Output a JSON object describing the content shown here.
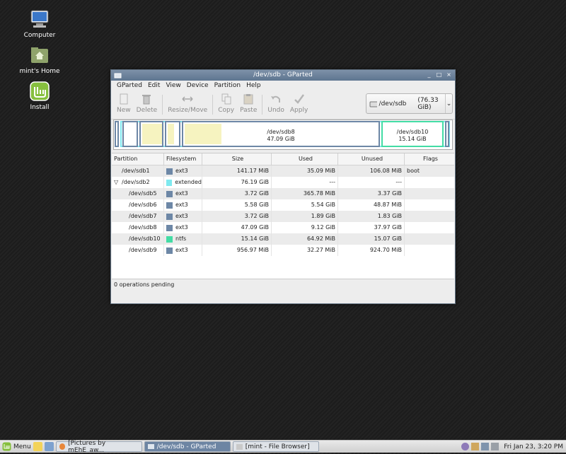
{
  "desktop": {
    "icons": [
      {
        "label": "Computer"
      },
      {
        "label": "mint's Home"
      },
      {
        "label": "Install"
      }
    ]
  },
  "window": {
    "title": "/dev/sdb - GParted",
    "menu": [
      "GParted",
      "Edit",
      "View",
      "Device",
      "Partition",
      "Help"
    ],
    "toolbar": {
      "new": "New",
      "delete": "Delete",
      "resize_move": "Resize/Move",
      "copy": "Copy",
      "paste": "Paste",
      "undo": "Undo",
      "apply": "Apply"
    },
    "device": {
      "name": "/dev/sdb",
      "size": "(76.33 GiB)"
    },
    "map": {
      "sdb8": {
        "name": "/dev/sdb8",
        "size": "47.09 GiB"
      },
      "sdb10": {
        "name": "/dev/sdb10",
        "size": "15.14 GiB"
      }
    },
    "columns": [
      "Partition",
      "Filesystem",
      "Size",
      "Used",
      "Unused",
      "Flags"
    ],
    "rows": [
      {
        "partition": "/dev/sdb1",
        "fs": "ext3",
        "size": "141.17 MiB",
        "used": "35.09 MiB",
        "unused": "106.08 MiB",
        "flags": "boot",
        "color": "#6d87a6"
      },
      {
        "partition": "/dev/sdb2",
        "fs": "extended",
        "size": "76.19 GiB",
        "used": "---",
        "unused": "---",
        "flags": "",
        "color": "#7fe9ef"
      },
      {
        "partition": "/dev/sdb5",
        "fs": "ext3",
        "size": "3.72 GiB",
        "used": "365.78 MiB",
        "unused": "3.37 GiB",
        "flags": "",
        "color": "#6d87a6"
      },
      {
        "partition": "/dev/sdb6",
        "fs": "ext3",
        "size": "5.58 GiB",
        "used": "5.54 GiB",
        "unused": "48.87 MiB",
        "flags": "",
        "color": "#6d87a6"
      },
      {
        "partition": "/dev/sdb7",
        "fs": "ext3",
        "size": "3.72 GiB",
        "used": "1.89 GiB",
        "unused": "1.83 GiB",
        "flags": "",
        "color": "#6d87a6"
      },
      {
        "partition": "/dev/sdb8",
        "fs": "ext3",
        "size": "47.09 GiB",
        "used": "9.12 GiB",
        "unused": "37.97 GiB",
        "flags": "",
        "color": "#6d87a6"
      },
      {
        "partition": "/dev/sdb10",
        "fs": "ntfs",
        "size": "15.14 GiB",
        "used": "64.92 MiB",
        "unused": "15.07 GiB",
        "flags": "",
        "color": "#43dca5"
      },
      {
        "partition": "/dev/sdb9",
        "fs": "ext3",
        "size": "956.97 MiB",
        "used": "32.27 MiB",
        "unused": "924.70 MiB",
        "flags": "",
        "color": "#6d87a6"
      }
    ],
    "status": "0 operations pending"
  },
  "taskbar": {
    "menu_label": "Menu",
    "tasks": [
      "[Pictures by mEhE_aw...",
      "/dev/sdb - GParted",
      "[mint - File Browser]"
    ],
    "clock": "Fri Jan 23,  3:20 PM"
  }
}
